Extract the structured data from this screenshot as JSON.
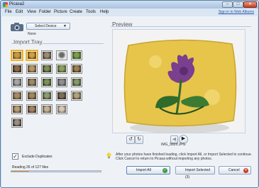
{
  "window": {
    "title": "Picasa2"
  },
  "menu": [
    "File",
    "Edit",
    "View",
    "Folder",
    "Picture",
    "Create",
    "Tools",
    "Help"
  ],
  "signin_link": "Sign in to Web Albums",
  "device": {
    "button_label": "Select Device",
    "value": "None"
  },
  "import_tray": {
    "title": "Import Tray",
    "thumbnails": [
      {
        "c1": "#c69a43",
        "c2": "#7a5a22",
        "selected": true
      },
      {
        "c1": "#cda247",
        "c2": "#6b4a1c",
        "selected": true
      },
      {
        "c1": "#9c8c74",
        "c2": "#4d4336"
      },
      {
        "c1": "#6b6b6b",
        "c2": "#e3e3e3"
      },
      {
        "c1": "#7d9b52",
        "c2": "#3b5a22"
      },
      {
        "c1": "#8a6b4a",
        "c2": "#3d2e20"
      },
      {
        "c1": "#b49a6a",
        "c2": "#5d4c30"
      },
      {
        "c1": "#7e8c5c",
        "c2": "#36401f"
      },
      {
        "c1": "#8da064",
        "c2": "#4a5a2c"
      },
      {
        "c1": "#9b7f55",
        "c2": "#4a3824"
      },
      {
        "c1": "#a6a6a6",
        "c2": "#555555"
      },
      {
        "c1": "#9a8a6a",
        "c2": "#4f4536"
      },
      {
        "c1": "#7f8f5a",
        "c2": "#3a4426"
      },
      {
        "c1": "#8f8f8f",
        "c2": "#4d4d4d"
      },
      {
        "c1": "#86996a",
        "c2": "#3e4b2c"
      },
      {
        "c1": "#a48b64",
        "c2": "#5a4a33"
      },
      {
        "c1": "#9f8560",
        "c2": "#574530"
      },
      {
        "c1": "#8b9b74",
        "c2": "#414f33"
      },
      {
        "c1": "#7f6d5a",
        "c2": "#3c3128"
      },
      {
        "c1": "#b1a27e",
        "c2": "#5c5038"
      },
      {
        "c1": "#b59e78",
        "c2": "#5a4b33"
      },
      {
        "c1": "#a08469",
        "c2": "#4d3c2c"
      },
      {
        "c1": "#c4b49a",
        "c2": "#6b5f4d"
      },
      {
        "c1": "#d2c9b8",
        "c2": "#7a7264"
      },
      {
        "c1": "#9a8f80",
        "c2": "#3f3a33"
      }
    ]
  },
  "exclude_duplicates": {
    "label": "Exclude Duplicates",
    "checked": true,
    "mark": "✓"
  },
  "progress": {
    "text": "Reading 26 of 127 files",
    "fraction": 0.2
  },
  "preview": {
    "title": "Preview",
    "filename": "IMG_0820.JPG",
    "rotate_left_icon": "↺",
    "rotate_right_icon": "↻",
    "prev_icon": "◀",
    "next_icon": "▶"
  },
  "hint": "After your photos have finished loading, click Import All, or Import Selected to continue. Click Cancel to return to Picasa without importing any photos.",
  "actions": {
    "import_all": "Import All",
    "import_all_badge": "✓",
    "import_selected": "Import Selected (3)",
    "cancel": "Cancel",
    "cancel_badge": "✕"
  },
  "window_controls": {
    "minimize": "–",
    "maximize": "□",
    "close": "✕"
  },
  "colors": {
    "accent": "#d98a2b",
    "pillow": "#e6c54a",
    "flower": "#7a3f8e",
    "leaves": "#2f6b2c"
  }
}
